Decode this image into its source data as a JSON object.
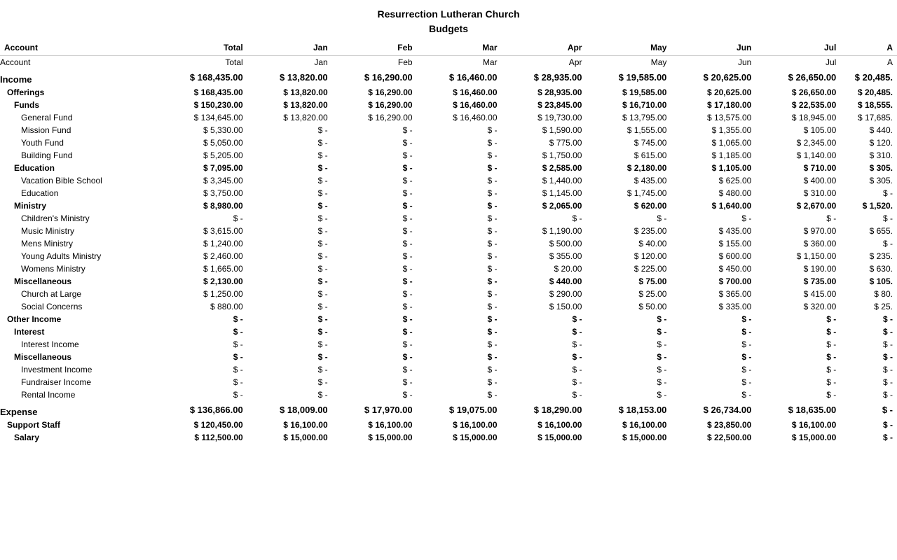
{
  "title": {
    "line1": "Resurrection Lutheran Church",
    "line2": "Budgets"
  },
  "columns": [
    "Account",
    "Total",
    "Jan",
    "Feb",
    "Mar",
    "Apr",
    "May",
    "Jun",
    "Jul",
    "A"
  ],
  "rows": [
    {
      "type": "header-row",
      "indent": 0,
      "account": "Account",
      "total": "Total",
      "jan": "Jan",
      "feb": "Feb",
      "mar": "Mar",
      "apr": "Apr",
      "may": "May",
      "jun": "Jun",
      "jul": "Jul",
      "aug": "A"
    },
    {
      "type": "section-total",
      "indent": 0,
      "account": "Income",
      "total": "$ 168,435.00",
      "jan": "$ 13,820.00",
      "feb": "$ 16,290.00",
      "mar": "$ 16,460.00",
      "apr": "$ 28,935.00",
      "may": "$ 19,585.00",
      "jun": "$ 20,625.00",
      "jul": "$ 26,650.00",
      "aug": "$ 20,485."
    },
    {
      "type": "category",
      "indent": 1,
      "account": "Offerings",
      "total": "$ 168,435.00",
      "jan": "$ 13,820.00",
      "feb": "$ 16,290.00",
      "mar": "$ 16,460.00",
      "apr": "$ 28,935.00",
      "may": "$ 19,585.00",
      "jun": "$ 20,625.00",
      "jul": "$ 26,650.00",
      "aug": "$ 20,485."
    },
    {
      "type": "subcategory",
      "indent": 2,
      "account": "Funds",
      "total": "$ 150,230.00",
      "jan": "$ 13,820.00",
      "feb": "$ 16,290.00",
      "mar": "$ 16,460.00",
      "apr": "$ 23,845.00",
      "may": "$ 16,710.00",
      "jun": "$ 17,180.00",
      "jul": "$ 22,535.00",
      "aug": "$ 18,555."
    },
    {
      "type": "detail",
      "indent": 3,
      "account": "General Fund",
      "total": "$ 134,645.00",
      "jan": "$ 13,820.00",
      "feb": "$ 16,290.00",
      "mar": "$ 16,460.00",
      "apr": "$ 19,730.00",
      "may": "$ 13,795.00",
      "jun": "$ 13,575.00",
      "jul": "$ 18,945.00",
      "aug": "$ 17,685."
    },
    {
      "type": "detail",
      "indent": 3,
      "account": "Mission Fund",
      "total": "$ 5,330.00",
      "jan": "$ -",
      "feb": "$ -",
      "mar": "$ -",
      "apr": "$ 1,590.00",
      "may": "$ 1,555.00",
      "jun": "$ 1,355.00",
      "jul": "$ 105.00",
      "aug": "$ 440."
    },
    {
      "type": "detail",
      "indent": 3,
      "account": "Youth Fund",
      "total": "$ 5,050.00",
      "jan": "$ -",
      "feb": "$ -",
      "mar": "$ -",
      "apr": "$ 775.00",
      "may": "$ 745.00",
      "jun": "$ 1,065.00",
      "jul": "$ 2,345.00",
      "aug": "$ 120."
    },
    {
      "type": "detail",
      "indent": 3,
      "account": "Building Fund",
      "total": "$ 5,205.00",
      "jan": "$ -",
      "feb": "$ -",
      "mar": "$ -",
      "apr": "$ 1,750.00",
      "may": "$ 615.00",
      "jun": "$ 1,185.00",
      "jul": "$ 1,140.00",
      "aug": "$ 310."
    },
    {
      "type": "subcategory",
      "indent": 2,
      "account": "Education",
      "total": "$ 7,095.00",
      "jan": "$ -",
      "feb": "$ -",
      "mar": "$ -",
      "apr": "$ 2,585.00",
      "may": "$ 2,180.00",
      "jun": "$ 1,105.00",
      "jul": "$ 710.00",
      "aug": "$ 305."
    },
    {
      "type": "detail",
      "indent": 3,
      "account": "Vacation Bible School",
      "total": "$ 3,345.00",
      "jan": "$ -",
      "feb": "$ -",
      "mar": "$ -",
      "apr": "$ 1,440.00",
      "may": "$ 435.00",
      "jun": "$ 625.00",
      "jul": "$ 400.00",
      "aug": "$ 305."
    },
    {
      "type": "detail",
      "indent": 3,
      "account": "Education",
      "total": "$ 3,750.00",
      "jan": "$ -",
      "feb": "$ -",
      "mar": "$ -",
      "apr": "$ 1,145.00",
      "may": "$ 1,745.00",
      "jun": "$ 480.00",
      "jul": "$ 310.00",
      "aug": "$ -"
    },
    {
      "type": "subcategory",
      "indent": 2,
      "account": "Ministry",
      "total": "$ 8,980.00",
      "jan": "$ -",
      "feb": "$ -",
      "mar": "$ -",
      "apr": "$ 2,065.00",
      "may": "$ 620.00",
      "jun": "$ 1,640.00",
      "jul": "$ 2,670.00",
      "aug": "$ 1,520."
    },
    {
      "type": "detail",
      "indent": 3,
      "account": "Children's Ministry",
      "total": "$ -",
      "jan": "$ -",
      "feb": "$ -",
      "mar": "$ -",
      "apr": "$ -",
      "may": "$ -",
      "jun": "$ -",
      "jul": "$ -",
      "aug": "$ -"
    },
    {
      "type": "detail",
      "indent": 3,
      "account": "Music Ministry",
      "total": "$ 3,615.00",
      "jan": "$ -",
      "feb": "$ -",
      "mar": "$ -",
      "apr": "$ 1,190.00",
      "may": "$ 235.00",
      "jun": "$ 435.00",
      "jul": "$ 970.00",
      "aug": "$ 655."
    },
    {
      "type": "detail",
      "indent": 3,
      "account": "Mens Ministry",
      "total": "$ 1,240.00",
      "jan": "$ -",
      "feb": "$ -",
      "mar": "$ -",
      "apr": "$ 500.00",
      "may": "$ 40.00",
      "jun": "$ 155.00",
      "jul": "$ 360.00",
      "aug": "$ -"
    },
    {
      "type": "detail",
      "indent": 3,
      "account": "Young Adults Ministry",
      "total": "$ 2,460.00",
      "jan": "$ -",
      "feb": "$ -",
      "mar": "$ -",
      "apr": "$ 355.00",
      "may": "$ 120.00",
      "jun": "$ 600.00",
      "jul": "$ 1,150.00",
      "aug": "$ 235."
    },
    {
      "type": "detail",
      "indent": 3,
      "account": "Womens Ministry",
      "total": "$ 1,665.00",
      "jan": "$ -",
      "feb": "$ -",
      "mar": "$ -",
      "apr": "$ 20.00",
      "may": "$ 225.00",
      "jun": "$ 450.00",
      "jul": "$ 190.00",
      "aug": "$ 630."
    },
    {
      "type": "subcategory",
      "indent": 2,
      "account": "Miscellaneous",
      "total": "$ 2,130.00",
      "jan": "$ -",
      "feb": "$ -",
      "mar": "$ -",
      "apr": "$ 440.00",
      "may": "$ 75.00",
      "jun": "$ 700.00",
      "jul": "$ 735.00",
      "aug": "$ 105."
    },
    {
      "type": "detail",
      "indent": 3,
      "account": "Church at Large",
      "total": "$ 1,250.00",
      "jan": "$ -",
      "feb": "$ -",
      "mar": "$ -",
      "apr": "$ 290.00",
      "may": "$ 25.00",
      "jun": "$ 365.00",
      "jul": "$ 415.00",
      "aug": "$ 80."
    },
    {
      "type": "detail",
      "indent": 3,
      "account": "Social Concerns",
      "total": "$ 880.00",
      "jan": "$ -",
      "feb": "$ -",
      "mar": "$ -",
      "apr": "$ 150.00",
      "may": "$ 50.00",
      "jun": "$ 335.00",
      "jul": "$ 320.00",
      "aug": "$ 25."
    },
    {
      "type": "category",
      "indent": 1,
      "account": "Other Income",
      "total": "$ -",
      "jan": "$ -",
      "feb": "$ -",
      "mar": "$ -",
      "apr": "$ -",
      "may": "$ -",
      "jun": "$ -",
      "jul": "$ -",
      "aug": "$ -"
    },
    {
      "type": "subcategory",
      "indent": 2,
      "account": "Interest",
      "total": "$ -",
      "jan": "$ -",
      "feb": "$ -",
      "mar": "$ -",
      "apr": "$ -",
      "may": "$ -",
      "jun": "$ -",
      "jul": "$ -",
      "aug": "$ -"
    },
    {
      "type": "detail",
      "indent": 3,
      "account": "Interest Income",
      "total": "$ -",
      "jan": "$ -",
      "feb": "$ -",
      "mar": "$ -",
      "apr": "$ -",
      "may": "$ -",
      "jun": "$ -",
      "jul": "$ -",
      "aug": "$ -"
    },
    {
      "type": "subcategory",
      "indent": 2,
      "account": "Miscellaneous",
      "total": "$ -",
      "jan": "$ -",
      "feb": "$ -",
      "mar": "$ -",
      "apr": "$ -",
      "may": "$ -",
      "jun": "$ -",
      "jul": "$ -",
      "aug": "$ -"
    },
    {
      "type": "detail",
      "indent": 3,
      "account": "Investment Income",
      "total": "$ -",
      "jan": "$ -",
      "feb": "$ -",
      "mar": "$ -",
      "apr": "$ -",
      "may": "$ -",
      "jun": "$ -",
      "jul": "$ -",
      "aug": "$ -"
    },
    {
      "type": "detail",
      "indent": 3,
      "account": "Fundraiser Income",
      "total": "$ -",
      "jan": "$ -",
      "feb": "$ -",
      "mar": "$ -",
      "apr": "$ -",
      "may": "$ -",
      "jun": "$ -",
      "jul": "$ -",
      "aug": "$ -"
    },
    {
      "type": "detail",
      "indent": 3,
      "account": "Rental Income",
      "total": "$ -",
      "jan": "$ -",
      "feb": "$ -",
      "mar": "$ -",
      "apr": "$ -",
      "may": "$ -",
      "jun": "$ -",
      "jul": "$ -",
      "aug": "$ -"
    },
    {
      "type": "section-total",
      "indent": 0,
      "account": "Expense",
      "total": "$ 136,866.00",
      "jan": "$ 18,009.00",
      "feb": "$ 17,970.00",
      "mar": "$ 19,075.00",
      "apr": "$ 18,290.00",
      "may": "$ 18,153.00",
      "jun": "$ 26,734.00",
      "jul": "$ 18,635.00",
      "aug": "$ -"
    },
    {
      "type": "category",
      "indent": 1,
      "account": "Support Staff",
      "total": "$ 120,450.00",
      "jan": "$ 16,100.00",
      "feb": "$ 16,100.00",
      "mar": "$ 16,100.00",
      "apr": "$ 16,100.00",
      "may": "$ 16,100.00",
      "jun": "$ 23,850.00",
      "jul": "$ 16,100.00",
      "aug": "$ -"
    },
    {
      "type": "subcategory",
      "indent": 2,
      "account": "Salary",
      "total": "$ 112,500.00",
      "jan": "$ 15,000.00",
      "feb": "$ 15,000.00",
      "mar": "$ 15,000.00",
      "apr": "$ 15,000.00",
      "may": "$ 15,000.00",
      "jun": "$ 22,500.00",
      "jul": "$ 15,000.00",
      "aug": "$ -"
    }
  ]
}
